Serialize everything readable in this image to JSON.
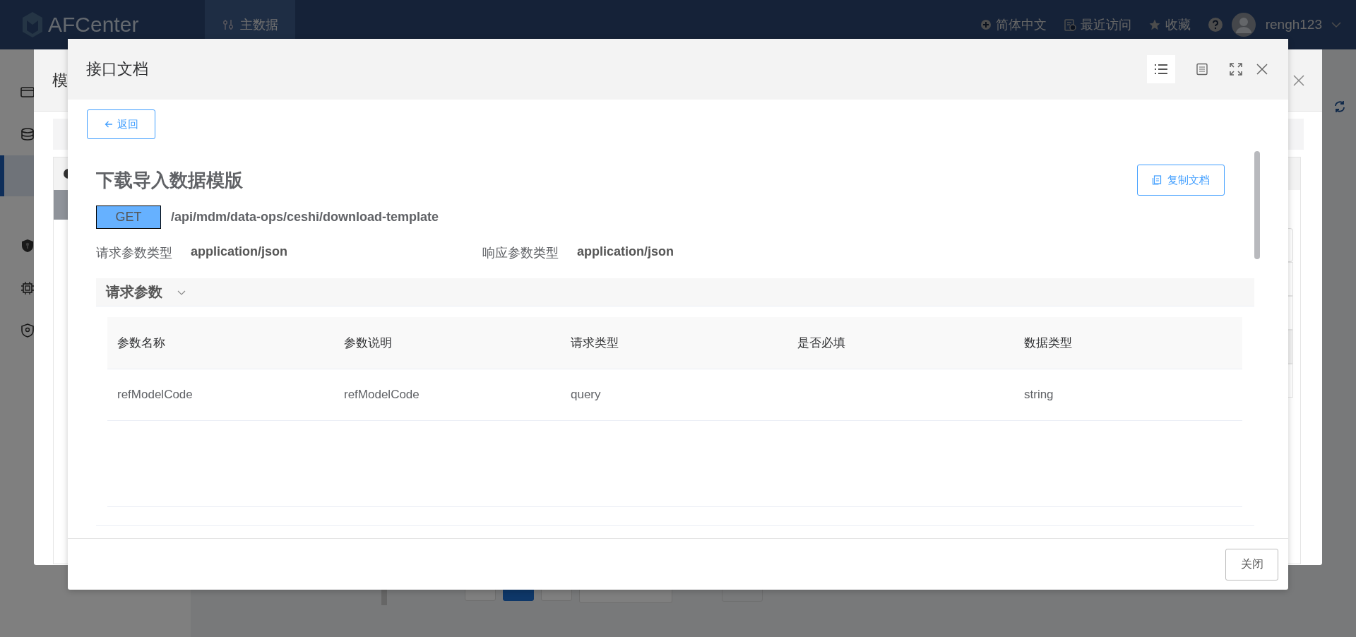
{
  "topbar": {
    "logo": "AFCenter",
    "nav": [
      {
        "label": "主数据",
        "selected": true
      }
    ],
    "actions": [
      {
        "kind": "language",
        "label": "简体中文"
      },
      {
        "kind": "recent",
        "label": "最近访问"
      },
      {
        "kind": "favorite",
        "label": "收藏"
      }
    ],
    "user": "rengh123"
  },
  "background_dialog": {
    "title": "模"
  },
  "pagination": {
    "pages": [
      {
        "selected": true
      }
    ]
  },
  "dialog": {
    "title": "接口文档",
    "view_modes": [
      {
        "kind": "list",
        "selected": true
      },
      {
        "kind": "doc",
        "selected": false
      }
    ],
    "back": "返回",
    "api_title": "下载导入数据模版",
    "copy": "复制文档",
    "method": "GET",
    "path": "/api/mdm/data-ops/ceshi/download-template",
    "request_type_label": "请求参数类型",
    "request_type": "application/json",
    "response_type_label": "响应参数类型",
    "response_type": "application/json",
    "section": {
      "title": "请求参数",
      "expanded": true
    },
    "table": {
      "columns": [
        "参数名称",
        "参数说明",
        "请求类型",
        "是否必填",
        "数据类型"
      ],
      "rows": [
        {
          "name": "refModelCode",
          "description": "refModelCode",
          "in": "query",
          "type": "string"
        }
      ]
    },
    "close": "关闭"
  }
}
